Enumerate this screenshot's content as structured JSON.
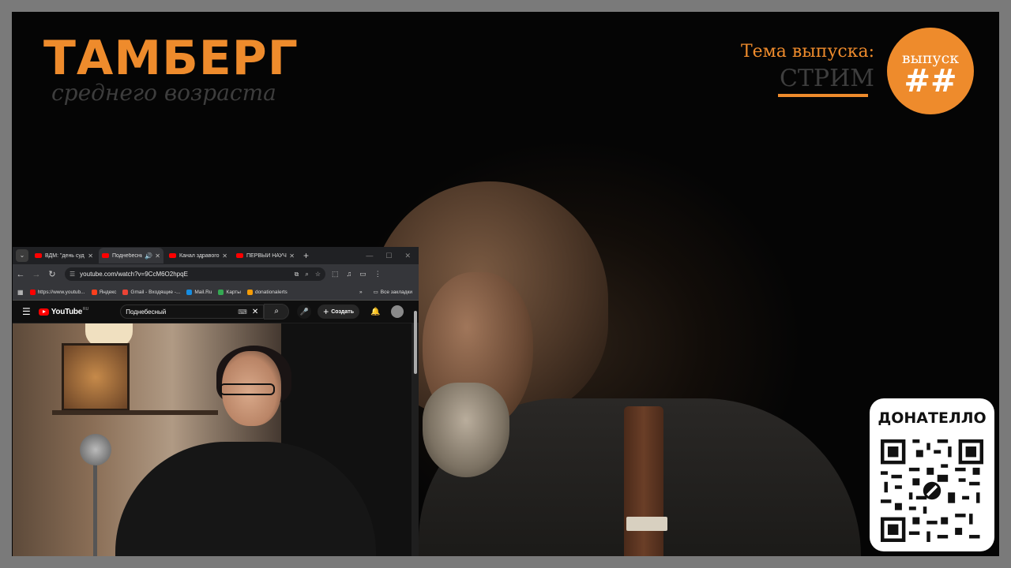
{
  "overlay": {
    "brand_title": "ТАМБЕРГ",
    "brand_subtitle": "среднего возраста",
    "topic_label": "Тема выпуска:",
    "topic_value": "СТРИМ",
    "episode_label": "выпуск",
    "episode_number": "##",
    "donate_title": "ДОНАТЕЛЛО",
    "accent_color": "#ee8b2c"
  },
  "browser": {
    "tabs": [
      {
        "title": "ВДМ: \"день суд",
        "active": false
      },
      {
        "title": "Поднебесный",
        "active": true,
        "audio": true
      },
      {
        "title": "Канал здравого",
        "active": false
      },
      {
        "title": "ПЕРВЫЙ НАУЧ",
        "active": false
      }
    ],
    "url": "youtube.com/watch?v=9CcM6O2hpqE",
    "bookmarks": [
      {
        "label": "https://www.youtub...",
        "color": "#ff0000"
      },
      {
        "label": "Яндекс",
        "color": "#fc3f1d"
      },
      {
        "label": "Gmail - Входящие -...",
        "color": "#ea4335"
      },
      {
        "label": "Mail.Ru",
        "color": "#168de2"
      },
      {
        "label": "Карты",
        "color": "#34a853"
      },
      {
        "label": "donationalerts",
        "color": "#f59c07"
      }
    ],
    "all_bookmarks_label": "Все закладки"
  },
  "youtube": {
    "logo_text": "YouTube",
    "country": "RU",
    "search_value": "Поднебесный",
    "create_label": "Создать"
  }
}
